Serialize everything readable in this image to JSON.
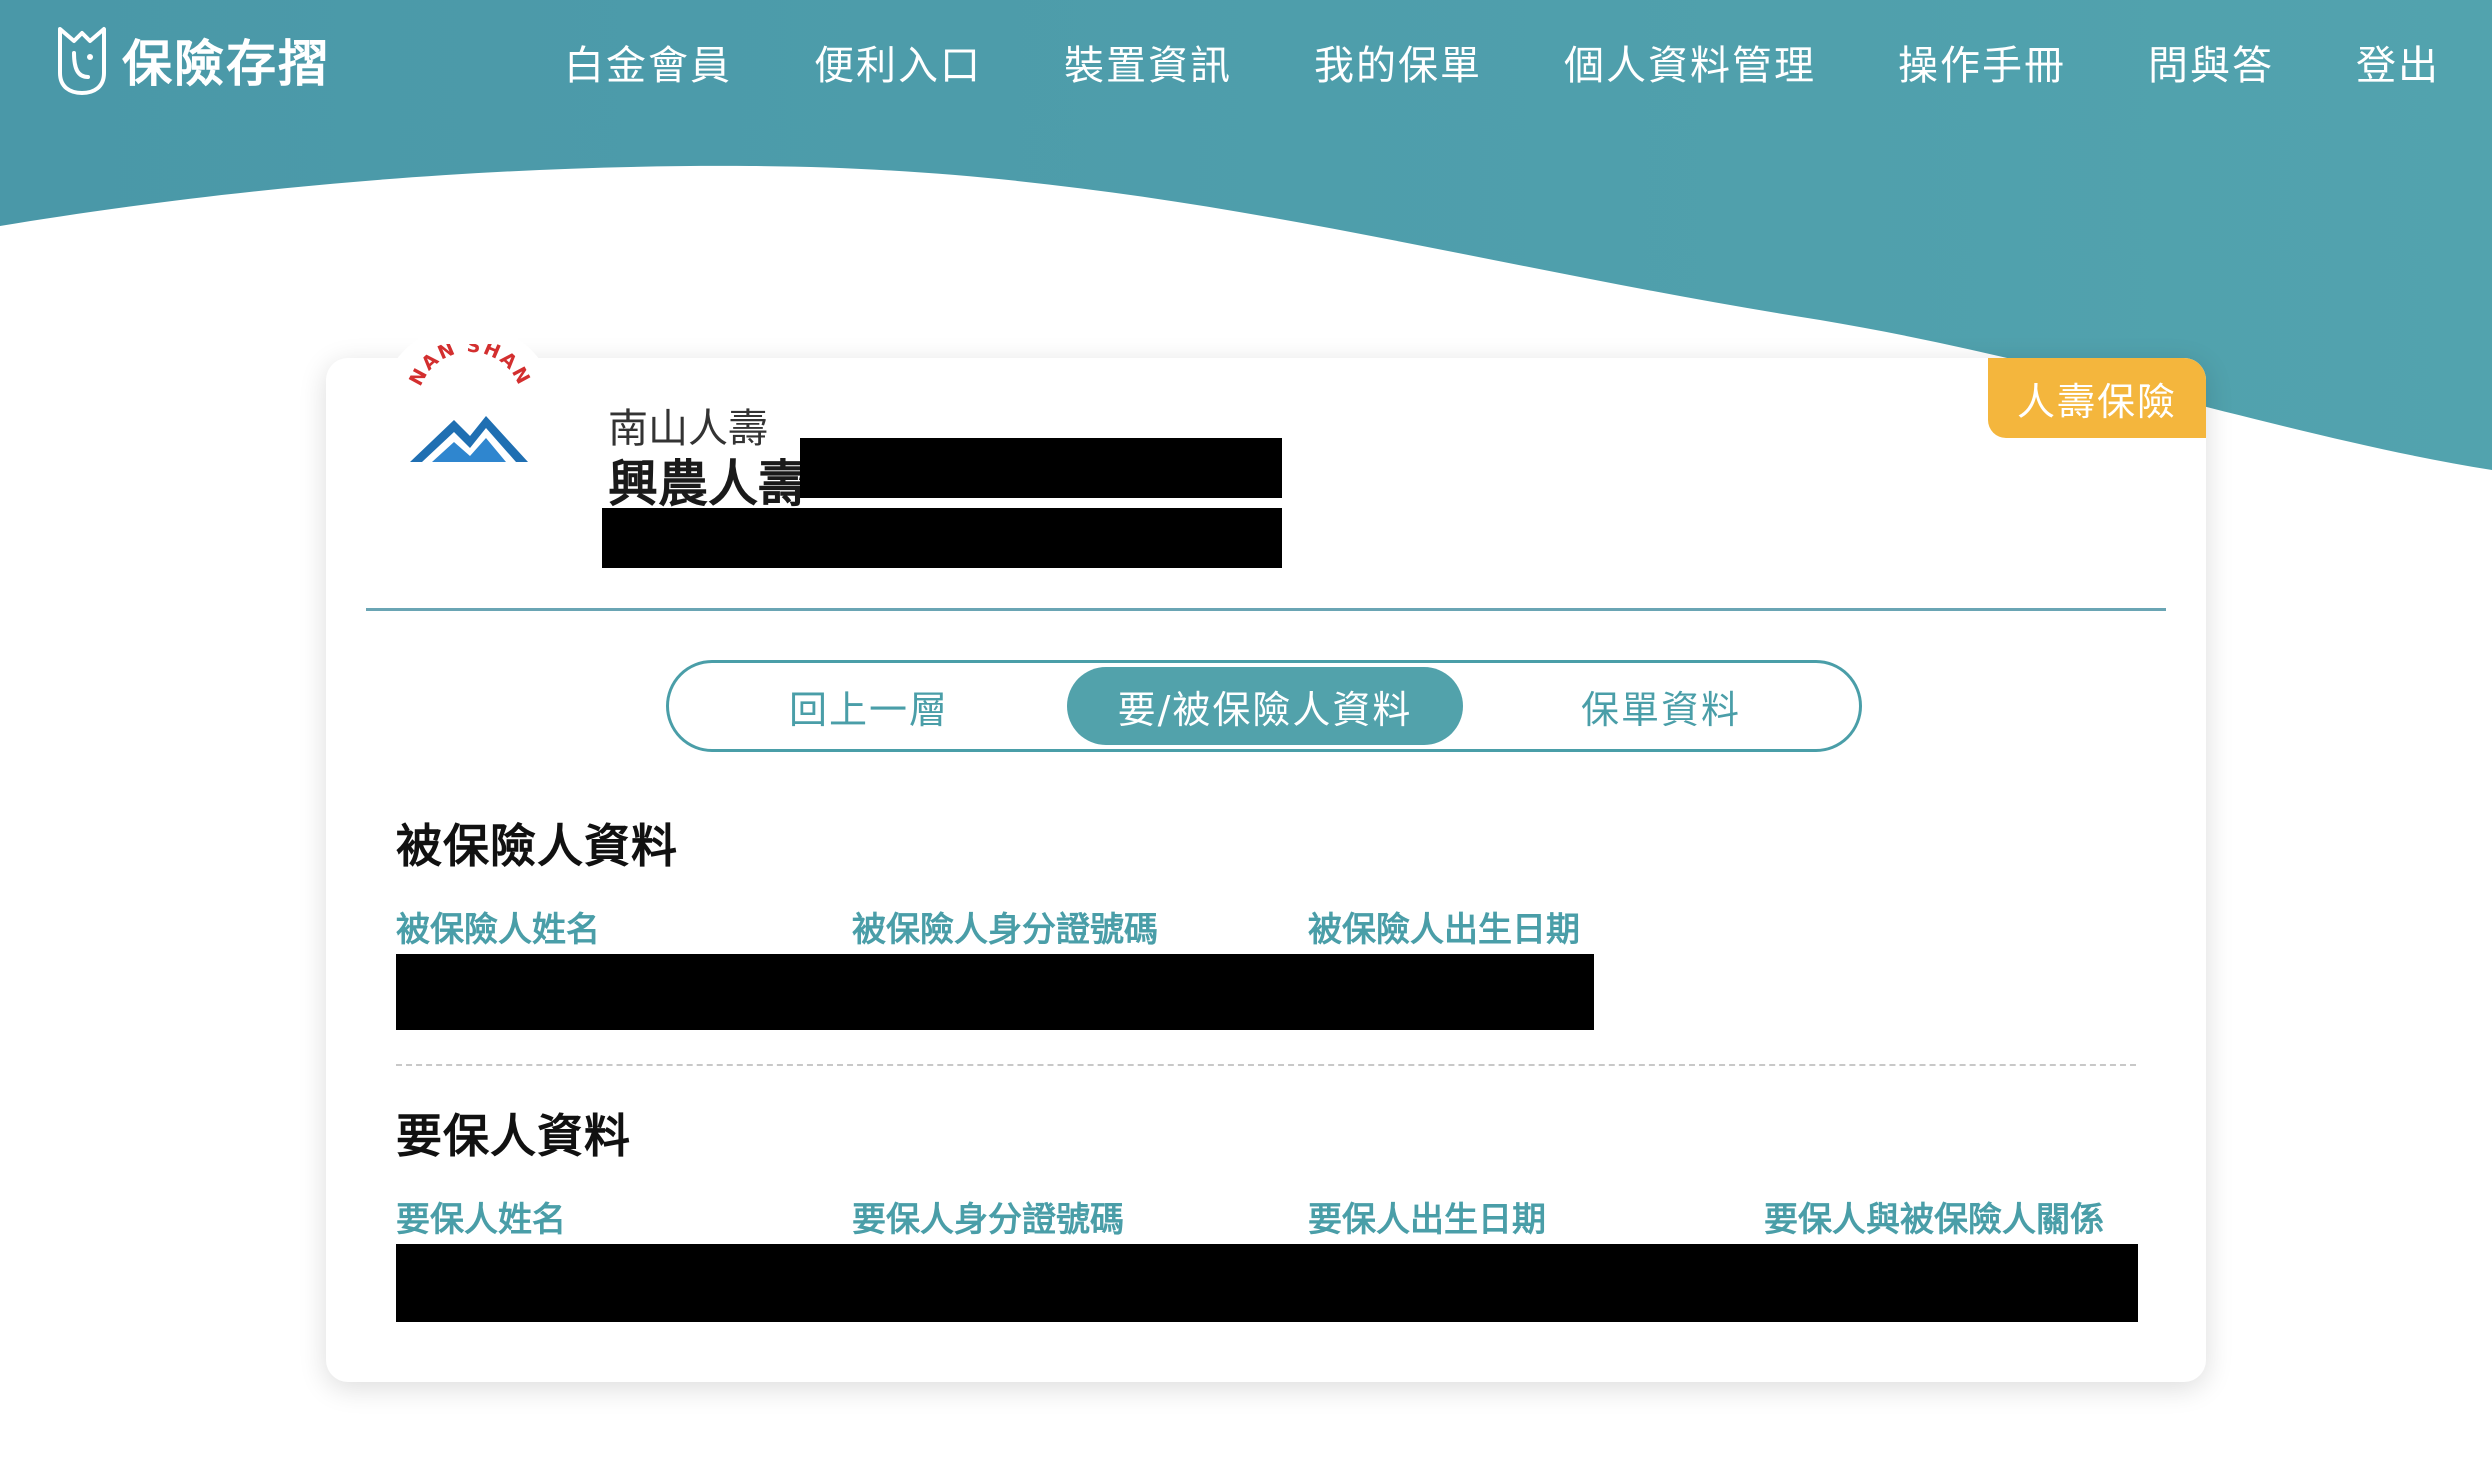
{
  "app": {
    "brand_name": "保險存摺"
  },
  "nav": {
    "items": [
      "白金會員",
      "便利入口",
      "裝置資訊",
      "我的保單",
      "個人資料管理",
      "操作手冊",
      "問與答",
      "登出"
    ]
  },
  "policy_card": {
    "category_badge": "人壽保險",
    "company_name": "南山人壽",
    "product_name": "興農人壽",
    "logo_text": "NAN SHAN",
    "tabs": [
      {
        "label": "回上一層",
        "active": false
      },
      {
        "label": "要/被保險人資料",
        "active": true
      },
      {
        "label": "保單資料",
        "active": false
      }
    ],
    "insured": {
      "title": "被保險人資料",
      "labels": [
        "被保險人姓名",
        "被保險人身分證號碼",
        "被保險人出生日期"
      ]
    },
    "policyholder": {
      "title": "要保人資料",
      "labels": [
        "要保人姓名",
        "要保人身分證號碼",
        "要保人出生日期",
        "要保人與被保險人關係"
      ]
    }
  },
  "colors": {
    "header_teal": "#4e9fad",
    "accent_teal": "#4a9ea8",
    "badge_yellow": "#f4b63d",
    "redaction": "#000000"
  }
}
